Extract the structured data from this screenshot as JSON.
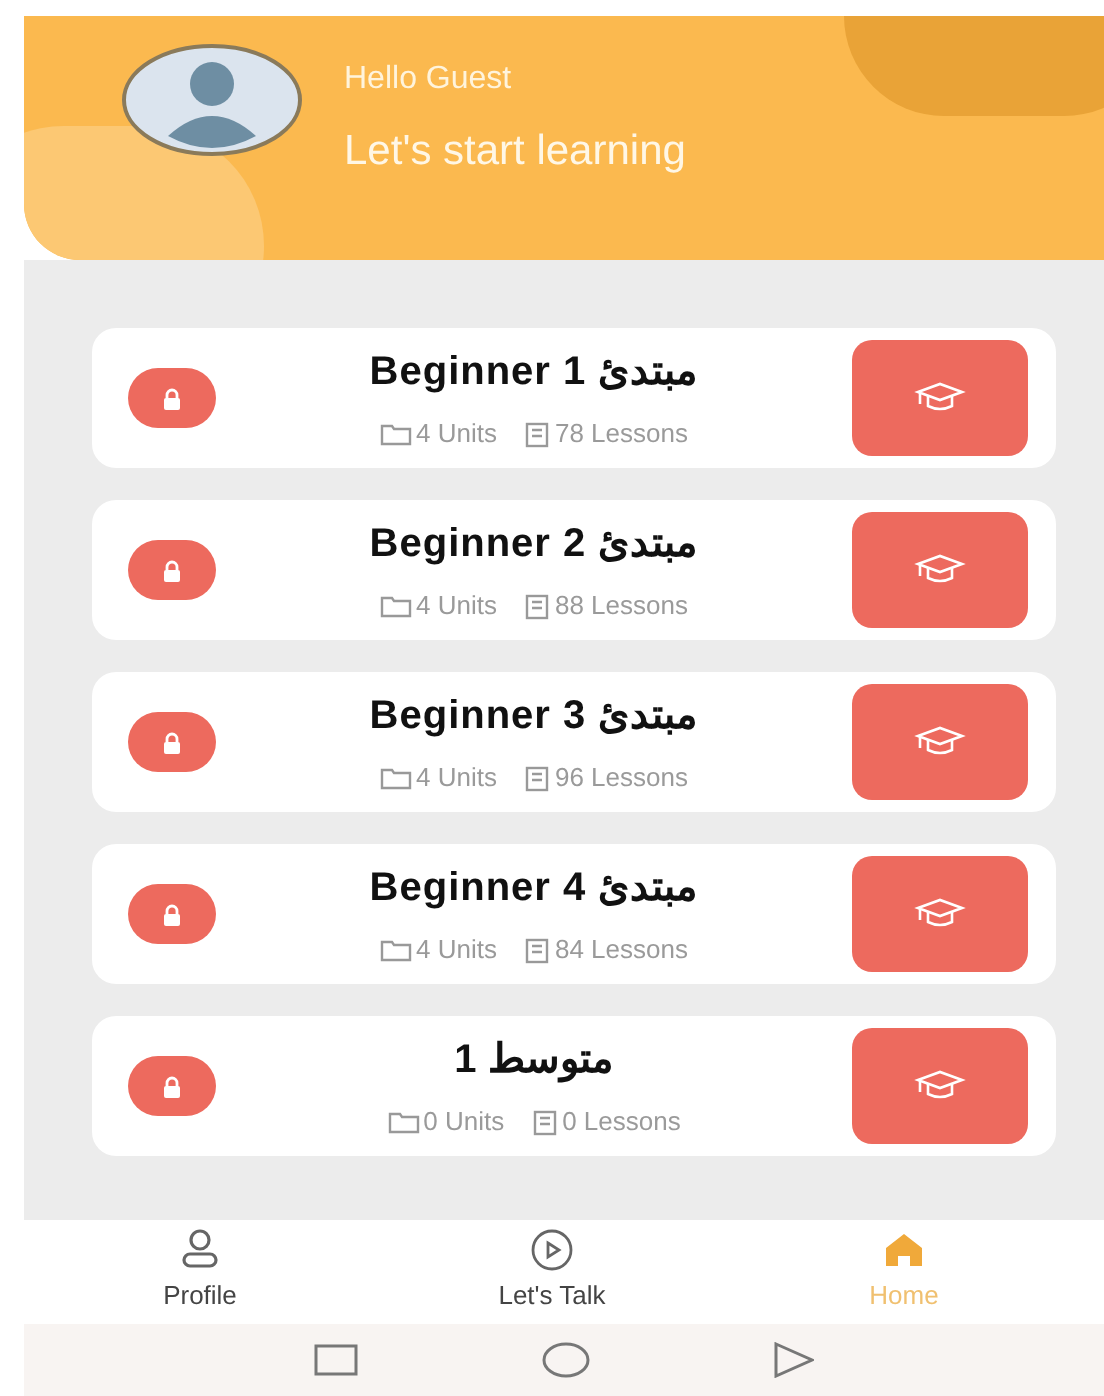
{
  "header": {
    "greeting": "Hello Guest",
    "subtitle": "Let's start learning"
  },
  "courses": [
    {
      "title": "Beginner 1 مبتدئ",
      "units": "4 Units",
      "lessons": "78 Lessons",
      "locked": true
    },
    {
      "title": "Beginner 2 مبتدئ",
      "units": "4 Units",
      "lessons": "88 Lessons",
      "locked": true
    },
    {
      "title": "Beginner 3 مبتدئ",
      "units": "4 Units",
      "lessons": "96 Lessons",
      "locked": true
    },
    {
      "title": "Beginner 4 مبتدئ",
      "units": "4 Units",
      "lessons": "84 Lessons",
      "locked": true
    },
    {
      "title": "متوسط 1",
      "units": "0 Units",
      "lessons": "0 Lessons",
      "locked": true
    }
  ],
  "nav": [
    {
      "label": "Profile",
      "kind": "profile",
      "selected": false
    },
    {
      "label": "Let's Talk",
      "kind": "talk",
      "selected": false
    },
    {
      "label": "Home",
      "kind": "home",
      "selected": true
    }
  ]
}
